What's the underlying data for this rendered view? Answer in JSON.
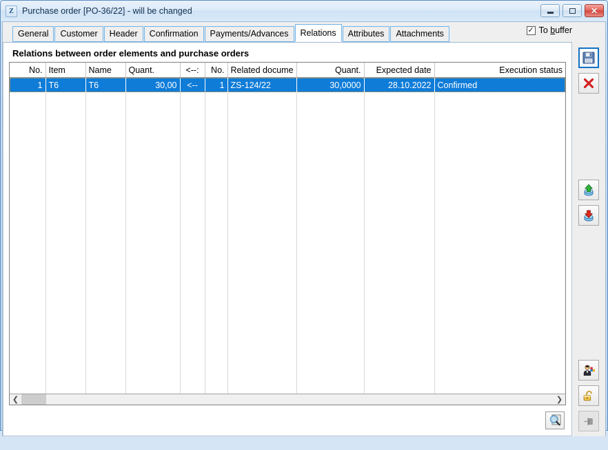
{
  "window": {
    "app_icon_glyph": "Z",
    "title": "Purchase order [PO-36/22] - will be changed",
    "minimize_label": "Minimize",
    "maximize_label": "Maximize",
    "close_label": "✕"
  },
  "tabs": [
    {
      "label": "General",
      "active": false
    },
    {
      "label": "Customer",
      "active": false
    },
    {
      "label": "Header",
      "active": false
    },
    {
      "label": "Confirmation",
      "active": false
    },
    {
      "label": "Payments/Advances",
      "active": false
    },
    {
      "label": "Relations",
      "active": true
    },
    {
      "label": "Attributes",
      "active": false
    },
    {
      "label": "Attachments",
      "active": false
    }
  ],
  "to_buffer": {
    "checked_glyph": "✓",
    "label_pre": "To ",
    "label_accel": "b",
    "label_post": "uffer"
  },
  "group": {
    "title": "Relations between order elements and purchase orders"
  },
  "grid": {
    "columns": [
      {
        "label": "No.",
        "align": "r"
      },
      {
        "label": "Item",
        "align": "l"
      },
      {
        "label": "Name",
        "align": "l"
      },
      {
        "label": "Quant.",
        "align": "r"
      },
      {
        "label": "<--:",
        "align": "c"
      },
      {
        "label": "No.",
        "align": "r"
      },
      {
        "label": "Related docume",
        "align": "l"
      },
      {
        "label": "Quant.",
        "align": "r"
      },
      {
        "label": "Expected date",
        "align": "r"
      },
      {
        "label": "Execution status",
        "align": "r"
      }
    ],
    "rows": [
      {
        "selected": true,
        "cells": [
          {
            "value": "1",
            "align": "r"
          },
          {
            "value": "T6",
            "align": "l"
          },
          {
            "value": "T6",
            "align": "l"
          },
          {
            "value": "30,00",
            "align": "r"
          },
          {
            "value": "<--",
            "align": "c"
          },
          {
            "value": "1",
            "align": "r"
          },
          {
            "value": "ZS-124/22",
            "align": "l"
          },
          {
            "value": "30,0000",
            "align": "r"
          },
          {
            "value": "28.10.2022",
            "align": "r"
          },
          {
            "value": "Confirmed",
            "align": "l"
          }
        ]
      }
    ]
  },
  "scrollbar": {
    "left_arrow": "❮",
    "right_arrow": "❯"
  },
  "footer": {
    "find_button_name": "find-document-button"
  },
  "toolbar": [
    {
      "name": "save-button",
      "icon": "floppy-disk-icon",
      "state": "primary"
    },
    {
      "name": "delete-button",
      "icon": "red-x-icon",
      "state": "normal"
    },
    {
      "name": "export-button",
      "icon": "export-up-arrow-icon",
      "state": "normal"
    },
    {
      "name": "import-button",
      "icon": "import-down-arrow-icon",
      "state": "normal"
    },
    {
      "name": "operator-button",
      "icon": "user-person-icon",
      "state": "normal"
    },
    {
      "name": "lock-button",
      "icon": "open-padlock-icon",
      "state": "normal"
    },
    {
      "name": "pin-button",
      "icon": "pin-icon",
      "state": "dim"
    }
  ],
  "colors": {
    "selection_blue": "#0f7cd8",
    "tab_border_blue": "#6fb3e8",
    "frame_blue": "#5b8ec4",
    "accent_save_border": "#1272c4"
  }
}
